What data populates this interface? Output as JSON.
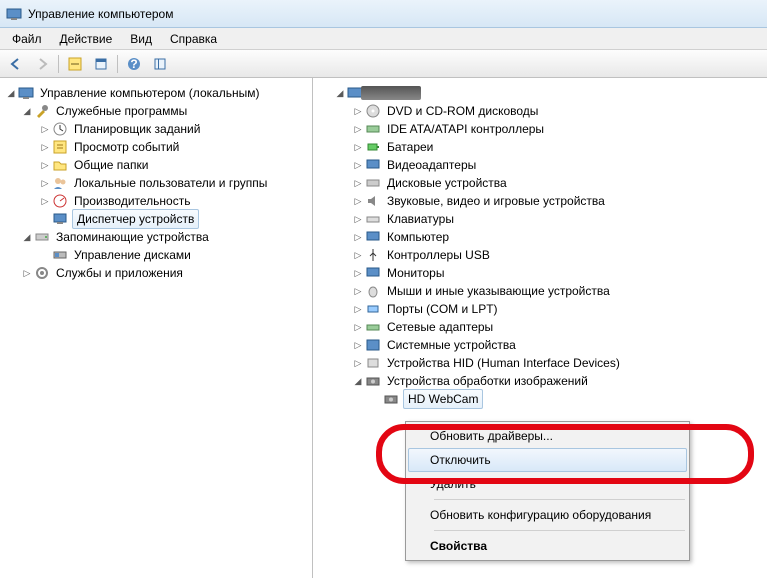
{
  "window": {
    "title": "Управление компьютером"
  },
  "menu": {
    "file": "Файл",
    "action": "Действие",
    "view": "Вид",
    "help": "Справка"
  },
  "left_tree": {
    "root": "Управление компьютером (локальным)",
    "system_tools": "Служебные программы",
    "task_scheduler": "Планировщик заданий",
    "event_viewer": "Просмотр событий",
    "shared_folders": "Общие папки",
    "local_users": "Локальные пользователи и группы",
    "performance": "Производительность",
    "device_manager": "Диспетчер устройств",
    "storage": "Запоминающие устройства",
    "disk_mgmt": "Управление дисками",
    "services": "Службы и приложения"
  },
  "right_tree": {
    "dvd": "DVD и CD-ROM дисководы",
    "ide": "IDE ATA/ATAPI контроллеры",
    "battery": "Батареи",
    "video": "Видеоадаптеры",
    "disk": "Дисковые устройства",
    "audio": "Звуковые, видео и игровые устройства",
    "keyboard": "Клавиатуры",
    "computer": "Компьютер",
    "usb": "Контроллеры USB",
    "monitor": "Мониторы",
    "mouse": "Мыши и иные указывающие устройства",
    "ports": "Порты (COM и LPT)",
    "net": "Сетевые адаптеры",
    "system": "Системные устройства",
    "hid": "Устройства HID (Human Interface Devices)",
    "imaging": "Устройства обработки изображений",
    "webcam": "HD WebCam"
  },
  "context": {
    "update_drivers": "Обновить драйверы...",
    "disable": "Отключить",
    "remove": "Удалить",
    "update_hw": "Обновить конфигурацию оборудования",
    "properties": "Свойства"
  }
}
